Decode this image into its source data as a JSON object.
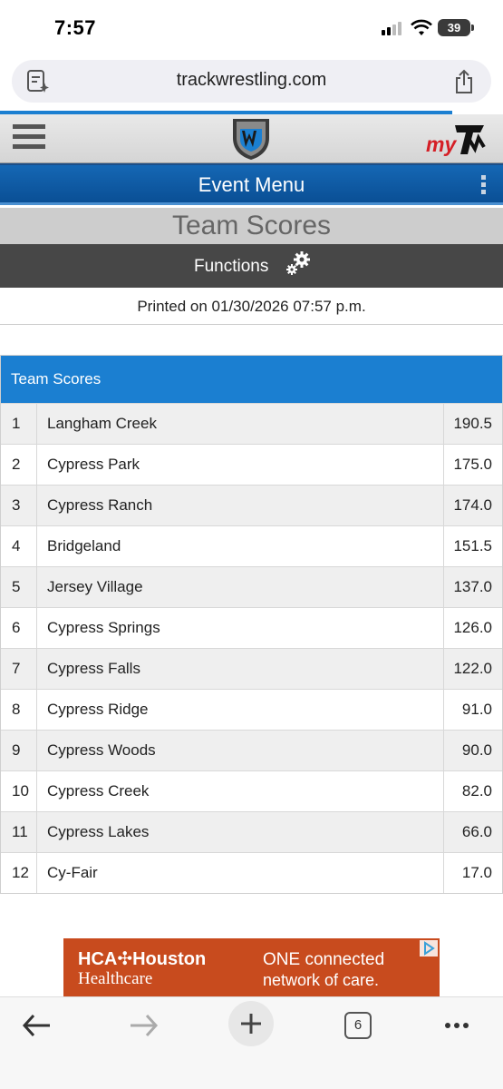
{
  "status_bar": {
    "time": "7:57",
    "battery": "39"
  },
  "browser": {
    "url": "trackwrestling.com",
    "open_tabs": "6"
  },
  "site": {
    "brand_my": "my",
    "event_menu": "Event Menu",
    "page_title": "Team Scores",
    "functions_label": "Functions",
    "printed_on": "Printed on 01/30/2026 07:57 p.m."
  },
  "team_scores": {
    "header": "Team Scores",
    "rows": [
      {
        "rank": "1",
        "team": "Langham Creek",
        "score": "190.5"
      },
      {
        "rank": "2",
        "team": "Cypress Park",
        "score": "175.0"
      },
      {
        "rank": "3",
        "team": "Cypress Ranch",
        "score": "174.0"
      },
      {
        "rank": "4",
        "team": "Bridgeland",
        "score": "151.5"
      },
      {
        "rank": "5",
        "team": "Jersey Village",
        "score": "137.0"
      },
      {
        "rank": "6",
        "team": "Cypress Springs",
        "score": "126.0"
      },
      {
        "rank": "7",
        "team": "Cypress Falls",
        "score": "122.0"
      },
      {
        "rank": "8",
        "team": "Cypress Ridge",
        "score": "91.0"
      },
      {
        "rank": "9",
        "team": "Cypress Woods",
        "score": "90.0"
      },
      {
        "rank": "10",
        "team": "Cypress Creek",
        "score": "82.0"
      },
      {
        "rank": "11",
        "team": "Cypress Lakes",
        "score": "66.0"
      },
      {
        "rank": "12",
        "team": "Cy-Fair",
        "score": "17.0"
      }
    ]
  },
  "ad": {
    "brand_line1": "HCA✣Houston",
    "brand_line2": "Healthcare",
    "message_line1": "ONE connected",
    "message_line2": "network of care."
  },
  "colors": {
    "accent": "#1b7fd1",
    "event_menu": "#0f5aa6",
    "functions_bar": "#474747",
    "ad_bg": "#c84b1e"
  }
}
